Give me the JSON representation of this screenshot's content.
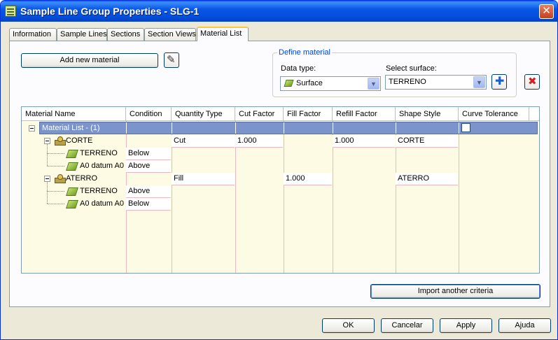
{
  "window": {
    "title": "Sample Line Group Properties - SLG-1",
    "close_label": "✕"
  },
  "tabs": [
    {
      "label": "Information"
    },
    {
      "label": "Sample Lines"
    },
    {
      "label": "Sections"
    },
    {
      "label": "Section Views"
    },
    {
      "label": "Material List"
    }
  ],
  "toolbar": {
    "add_material_label": "Add new material"
  },
  "define_material": {
    "legend": "Define material",
    "data_type_label": "Data type:",
    "data_type_value": "Surface",
    "surface_label": "Select surface:",
    "surface_value": "TERRENO"
  },
  "grid": {
    "columns": [
      "Material Name",
      "Condition",
      "Quantity Type",
      "Cut Factor",
      "Fill Factor",
      "Refill Factor",
      "Shape Style",
      "Curve Tolerance"
    ],
    "root_label": "Material List - (1)",
    "materials": [
      {
        "name": "CORTE",
        "quantity_type": "Cut",
        "cut_factor": "1.000",
        "fill_factor": "",
        "refill_factor": "1.000",
        "shape_style": "CORTE",
        "surfaces": [
          {
            "name": "TERRENO",
            "condition": "Below"
          },
          {
            "name": "A0 datum A0",
            "condition": "Above"
          }
        ]
      },
      {
        "name": "ATERRO",
        "quantity_type": "Fill",
        "cut_factor": "",
        "fill_factor": "1.000",
        "refill_factor": "",
        "shape_style": "ATERRO",
        "surfaces": [
          {
            "name": "TERRENO",
            "condition": "Above"
          },
          {
            "name": "A0 datum A0",
            "condition": "Below"
          }
        ]
      }
    ]
  },
  "buttons": {
    "import_label": "Import another criteria",
    "ok_label": "OK",
    "cancel_label": "Cancelar",
    "apply_label": "Apply",
    "help_label": "Ajuda"
  },
  "icons": {
    "surface": "surface-icon",
    "material": "material-icon",
    "pick": "pick-pencil-icon",
    "add": "plus-icon",
    "delete": "delete-x-icon"
  },
  "colors": {
    "selected_row": "#7b94cc",
    "grid_body": "#fefbe4",
    "titlebar": "#0857e6"
  }
}
